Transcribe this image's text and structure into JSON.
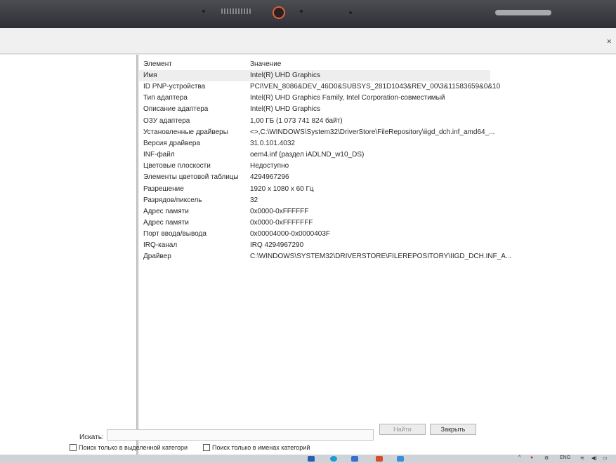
{
  "columns": {
    "element": "Элемент",
    "value": "Значение"
  },
  "rows": [
    {
      "name": "Имя",
      "value": "Intel(R) UHD Graphics"
    },
    {
      "name": "ID PNP-устройства",
      "value": "PCI\\VEN_8086&DEV_46D0&SUBSYS_281D1043&REV_00\\3&11583659&0&10"
    },
    {
      "name": "Тип адаптера",
      "value": "Intel(R) UHD Graphics Family, Intel Corporation-совместимый"
    },
    {
      "name": "Описание адаптера",
      "value": "Intel(R) UHD Graphics"
    },
    {
      "name": "ОЗУ адаптера",
      "value": "1,00 ГБ (1 073 741 824 байт)"
    },
    {
      "name": "Установленные драйверы",
      "value": "<>,C:\\WINDOWS\\System32\\DriverStore\\FileRepository\\iigd_dch.inf_amd64_..."
    },
    {
      "name": "Версия драйвера",
      "value": "31.0.101.4032"
    },
    {
      "name": "INF-файл",
      "value": "oem4.inf (раздел iADLND_w10_DS)"
    },
    {
      "name": "Цветовые плоскости",
      "value": "Недоступно"
    },
    {
      "name": "Элементы цветовой таблицы",
      "value": "4294967296"
    },
    {
      "name": "Разрешение",
      "value": "1920 x 1080 x 60 Гц"
    },
    {
      "name": "Разрядов/пиксель",
      "value": "32"
    },
    {
      "name": "Адрес памяти",
      "value": "0x0000-0xFFFFFF"
    },
    {
      "name": "Адрес памяти",
      "value": "0x0000-0xFFFFFFF"
    },
    {
      "name": "Порт ввода/вывода",
      "value": "0x00004000-0x0000403F"
    },
    {
      "name": "IRQ-канал",
      "value": "IRQ 4294967290"
    },
    {
      "name": "Драйвер",
      "value": "C:\\WINDOWS\\SYSTEM32\\DRIVERSTORE\\FILEREPOSITORY\\IIGD_DCH.INF_A..."
    }
  ],
  "search": {
    "label": "Искать:",
    "value": "",
    "find_button": "Найти",
    "close_button": "Закрыть",
    "option_selected_category": "Поиск только в выделенной категори",
    "option_category_names": "Поиск только в именах категорий"
  },
  "taskbar": {
    "language": "ENG"
  },
  "colors": {
    "window_bg": "#ffffff",
    "selected_row": "#eeeeee",
    "bezel": "#2e3035"
  }
}
